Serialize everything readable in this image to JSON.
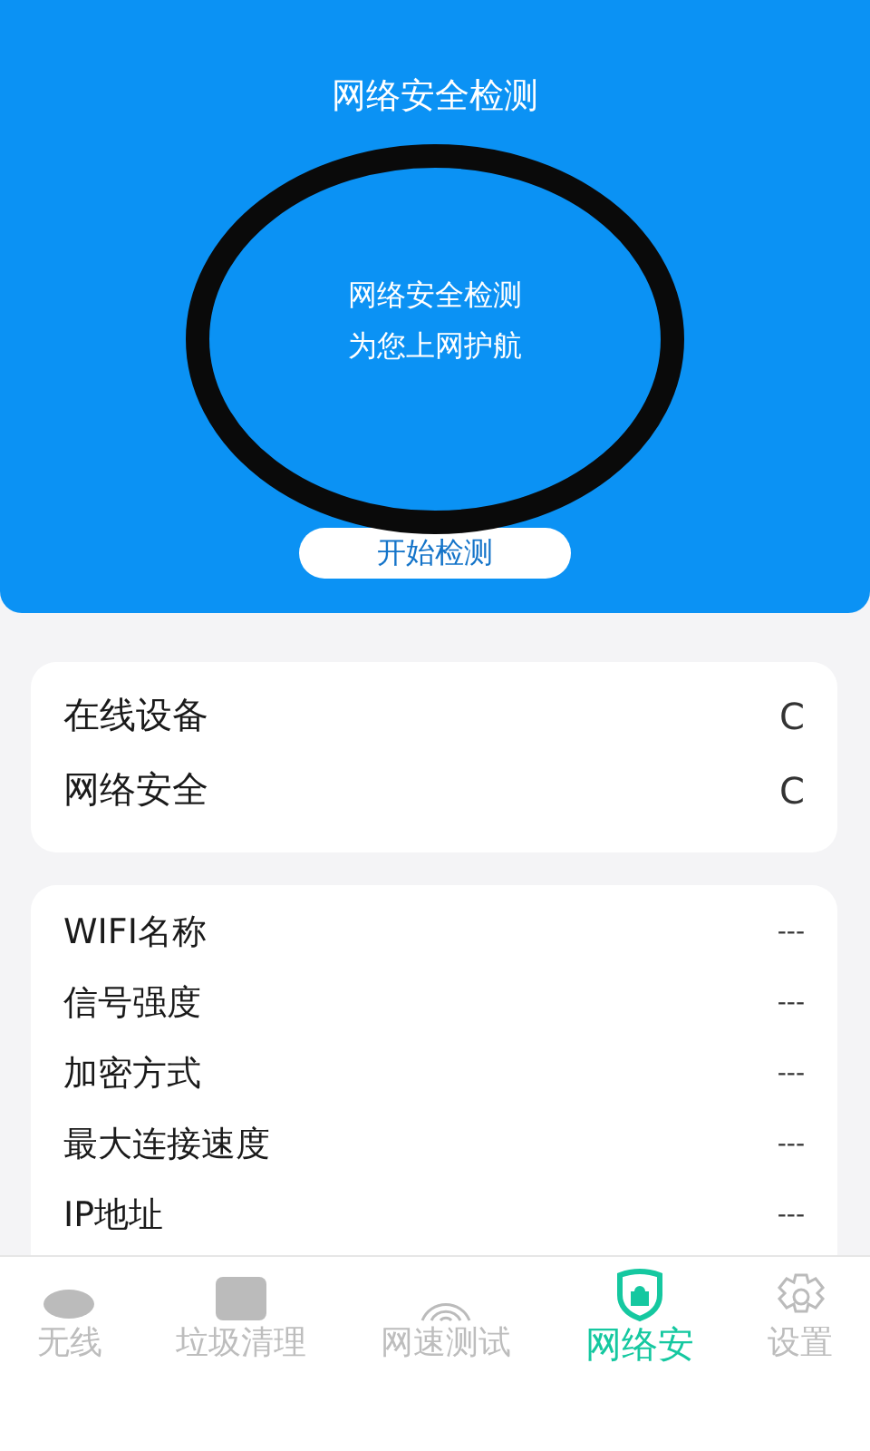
{
  "header": {
    "title": "网络安全检测",
    "ring_lines": [
      "网络安全检测",
      "为您上网护航"
    ],
    "start_button": "开始检测"
  },
  "status_card": [
    {
      "label": "在线设备",
      "value": "C"
    },
    {
      "label": "网络安全",
      "value": "C"
    }
  ],
  "info_card": [
    {
      "label": "WIFI名称",
      "value": "---"
    },
    {
      "label": "信号强度",
      "value": "---"
    },
    {
      "label": "加密方式",
      "value": "---"
    },
    {
      "label": "最大连接速度",
      "value": "---"
    },
    {
      "label": "IP地址",
      "value": "---"
    }
  ],
  "tabs": [
    {
      "kind": "ellipse",
      "label": "无线",
      "selected": false
    },
    {
      "kind": "square",
      "label": "垃圾清理",
      "selected": false
    },
    {
      "kind": "wifi",
      "label": "网速测试",
      "selected": false
    },
    {
      "kind": "shield",
      "label": "网络安",
      "selected": true
    },
    {
      "kind": "gear",
      "label": "设置",
      "selected": false
    }
  ]
}
